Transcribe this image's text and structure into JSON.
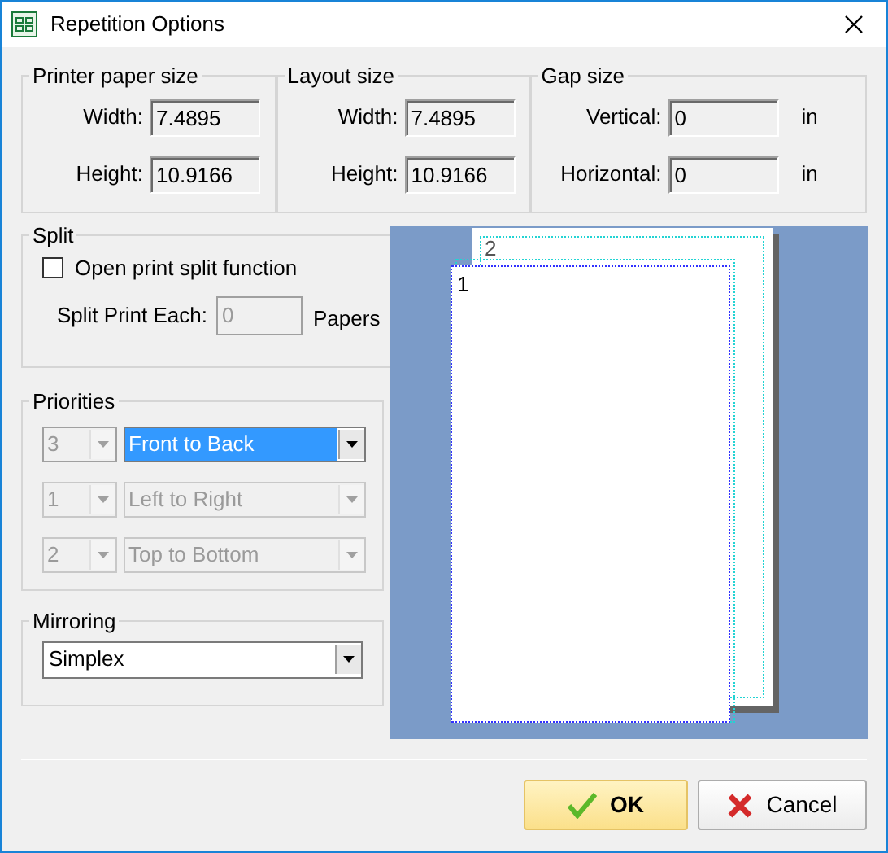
{
  "window": {
    "title": "Repetition Options"
  },
  "size_groups": [
    {
      "title": "Printer paper size",
      "fields": [
        {
          "label": "Width:",
          "value": "7.4895"
        },
        {
          "label": "Height:",
          "value": "10.9166"
        }
      ]
    },
    {
      "title": "Layout size",
      "fields": [
        {
          "label": "Width:",
          "value": "7.4895"
        },
        {
          "label": "Height:",
          "value": "10.9166"
        }
      ]
    },
    {
      "title": "Gap size",
      "fields": [
        {
          "label": "Vertical:",
          "value": "0",
          "unit": "in"
        },
        {
          "label": "Horizontal:",
          "value": "0",
          "unit": "in"
        }
      ]
    }
  ],
  "split": {
    "title": "Split",
    "checkbox": {
      "label": "Open print split function",
      "checked": false
    },
    "each": {
      "label": "Split Print Each:",
      "value": "0",
      "unit": "Papers",
      "disabled": true
    }
  },
  "priorities": {
    "title": "Priorities",
    "rows": [
      {
        "order": "3",
        "direction": "Front to Back",
        "disabled": false,
        "selected": true
      },
      {
        "order": "1",
        "direction": "Left to Right",
        "disabled": true,
        "selected": false
      },
      {
        "order": "2",
        "direction": "Top to Bottom",
        "disabled": true,
        "selected": false
      }
    ]
  },
  "mirroring": {
    "title": "Mirroring",
    "value": "Simplex"
  },
  "preview": {
    "pages": [
      "1",
      "2"
    ]
  },
  "buttons": [
    {
      "kind": "ok",
      "label": "OK"
    },
    {
      "kind": "cancel",
      "label": "Cancel"
    }
  ]
}
